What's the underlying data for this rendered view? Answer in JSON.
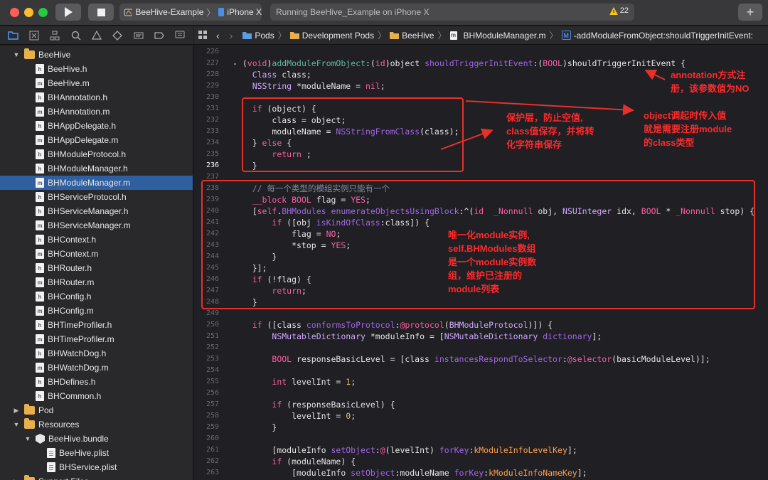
{
  "toolbar": {
    "scheme": "BeeHive-Example",
    "device": "iPhone X",
    "status": "Running BeeHive_Example on iPhone X",
    "warnings": "22",
    "colors": {
      "close": "#ff5f57",
      "minimize": "#febc2e",
      "zoom": "#28c840"
    }
  },
  "jumpbar": {
    "items": [
      "Pods",
      "Development Pods",
      "BeeHive",
      "BHModuleManager.m",
      "-addModuleFromObject:shouldTriggerInitEvent:"
    ]
  },
  "navigator": {
    "rows": [
      {
        "label": "BeeHive",
        "type": "folder",
        "indent": 1,
        "disclosure": "open"
      },
      {
        "label": "BeeHive.h",
        "type": "h",
        "indent": 2
      },
      {
        "label": "BeeHive.m",
        "type": "m",
        "indent": 2
      },
      {
        "label": "BHAnnotation.h",
        "type": "h",
        "indent": 2
      },
      {
        "label": "BHAnnotation.m",
        "type": "m",
        "indent": 2
      },
      {
        "label": "BHAppDelegate.h",
        "type": "h",
        "indent": 2
      },
      {
        "label": "BHAppDelegate.m",
        "type": "m",
        "indent": 2
      },
      {
        "label": "BHModuleProtocol.h",
        "type": "h",
        "indent": 2
      },
      {
        "label": "BHModuleManager.h",
        "type": "h",
        "indent": 2
      },
      {
        "label": "BHModuleManager.m",
        "type": "m",
        "indent": 2,
        "selected": true
      },
      {
        "label": "BHServiceProtocol.h",
        "type": "h",
        "indent": 2
      },
      {
        "label": "BHServiceManager.h",
        "type": "h",
        "indent": 2
      },
      {
        "label": "BHServiceManager.m",
        "type": "m",
        "indent": 2
      },
      {
        "label": "BHContext.h",
        "type": "h",
        "indent": 2
      },
      {
        "label": "BHContext.m",
        "type": "m",
        "indent": 2
      },
      {
        "label": "BHRouter.h",
        "type": "h",
        "indent": 2
      },
      {
        "label": "BHRouter.m",
        "type": "m",
        "indent": 2
      },
      {
        "label": "BHConfig.h",
        "type": "h",
        "indent": 2
      },
      {
        "label": "BHConfig.m",
        "type": "m",
        "indent": 2
      },
      {
        "label": "BHTimeProfiler.h",
        "type": "h",
        "indent": 2
      },
      {
        "label": "BHTimeProfiler.m",
        "type": "m",
        "indent": 2
      },
      {
        "label": "BHWatchDog.h",
        "type": "h",
        "indent": 2
      },
      {
        "label": "BHWatchDog.m",
        "type": "m",
        "indent": 2
      },
      {
        "label": "BHDefines.h",
        "type": "h",
        "indent": 2
      },
      {
        "label": "BHCommon.h",
        "type": "h",
        "indent": 2
      },
      {
        "label": "Pod",
        "type": "folder",
        "indent": 1,
        "disclosure": "closed"
      },
      {
        "label": "Resources",
        "type": "folder",
        "indent": 1,
        "disclosure": "open"
      },
      {
        "label": "BeeHive.bundle",
        "type": "bundle",
        "indent": 2,
        "disclosure": "open"
      },
      {
        "label": "BeeHive.plist",
        "type": "plist",
        "indent": 3
      },
      {
        "label": "BHService.plist",
        "type": "plist",
        "indent": 3
      },
      {
        "label": "Support Files",
        "type": "folder",
        "indent": 1,
        "disclosure": "closed"
      }
    ]
  },
  "editor": {
    "current_line": "236",
    "lines": [
      {
        "n": "226",
        "tokens": []
      },
      {
        "n": "227",
        "tokens": [
          [
            "- (",
            "p"
          ],
          [
            "void",
            "k"
          ],
          [
            ")",
            "p"
          ],
          [
            "addModuleFromObject",
            "fn"
          ],
          [
            ":(",
            "p"
          ],
          [
            "id",
            "k"
          ],
          [
            ")object ",
            "p"
          ],
          [
            "shouldTriggerInitEvent",
            "pa"
          ],
          [
            ":(",
            "p"
          ],
          [
            "BOOL",
            "k"
          ],
          [
            ")shouldTriggerInitEvent {",
            "p"
          ]
        ]
      },
      {
        "n": "228",
        "tokens": [
          [
            "    ",
            "p"
          ],
          [
            "Class",
            "t"
          ],
          [
            " class;",
            "p"
          ]
        ]
      },
      {
        "n": "229",
        "tokens": [
          [
            "    ",
            "p"
          ],
          [
            "NSString",
            "t"
          ],
          [
            " *moduleName = ",
            "p"
          ],
          [
            "nil",
            "k"
          ],
          [
            ";",
            "p"
          ]
        ]
      },
      {
        "n": "230",
        "tokens": []
      },
      {
        "n": "231",
        "tokens": [
          [
            "    ",
            "p"
          ],
          [
            "if",
            "k"
          ],
          [
            " (object) {",
            "p"
          ]
        ]
      },
      {
        "n": "232",
        "tokens": [
          [
            "        class = object;",
            "p"
          ]
        ]
      },
      {
        "n": "233",
        "tokens": [
          [
            "        moduleName = ",
            "p"
          ],
          [
            "NSStringFromClass",
            "pa"
          ],
          [
            "(class);",
            "p"
          ]
        ]
      },
      {
        "n": "234",
        "tokens": [
          [
            "    } ",
            "p"
          ],
          [
            "else",
            "k"
          ],
          [
            " {",
            "p"
          ]
        ]
      },
      {
        "n": "235",
        "tokens": [
          [
            "        ",
            "p"
          ],
          [
            "return",
            "k"
          ],
          [
            " ;",
            "p"
          ]
        ]
      },
      {
        "n": "236",
        "tokens": [
          [
            "    }",
            "p"
          ]
        ]
      },
      {
        "n": "237",
        "tokens": []
      },
      {
        "n": "238",
        "tokens": [
          [
            "    ",
            "p"
          ],
          [
            "// 每一个类型的模组实例只能有一个",
            "c"
          ]
        ]
      },
      {
        "n": "239",
        "tokens": [
          [
            "    ",
            "p"
          ],
          [
            "__block",
            "k"
          ],
          [
            " ",
            "p"
          ],
          [
            "BOOL",
            "k"
          ],
          [
            " flag = ",
            "p"
          ],
          [
            "YES",
            "k"
          ],
          [
            ";",
            "p"
          ]
        ]
      },
      {
        "n": "240",
        "tokens": [
          [
            "    [",
            "p"
          ],
          [
            "self",
            "k"
          ],
          [
            ".",
            "p"
          ],
          [
            "BHModules",
            "pa"
          ],
          [
            " ",
            "p"
          ],
          [
            "enumerateObjectsUsingBlock",
            "pa"
          ],
          [
            ":^(",
            "p"
          ],
          [
            "id",
            "k"
          ],
          [
            "  ",
            "p"
          ],
          [
            "_Nonnull",
            "k"
          ],
          [
            " obj, ",
            "p"
          ],
          [
            "NSUInteger",
            "t"
          ],
          [
            " idx, ",
            "p"
          ],
          [
            "BOOL",
            "k"
          ],
          [
            " * ",
            "p"
          ],
          [
            "_Nonnull",
            "k"
          ],
          [
            " stop) {",
            "p"
          ]
        ]
      },
      {
        "n": "241",
        "tokens": [
          [
            "        ",
            "p"
          ],
          [
            "if",
            "k"
          ],
          [
            " ([obj ",
            "p"
          ],
          [
            "isKindOfClass",
            "pa"
          ],
          [
            ":class]) {",
            "p"
          ]
        ]
      },
      {
        "n": "242",
        "tokens": [
          [
            "            flag = ",
            "p"
          ],
          [
            "NO",
            "k"
          ],
          [
            ";",
            "p"
          ]
        ]
      },
      {
        "n": "243",
        "tokens": [
          [
            "            *stop = ",
            "p"
          ],
          [
            "YES",
            "k"
          ],
          [
            ";",
            "p"
          ]
        ]
      },
      {
        "n": "244",
        "tokens": [
          [
            "        }",
            "p"
          ]
        ]
      },
      {
        "n": "245",
        "tokens": [
          [
            "    }];",
            "p"
          ]
        ]
      },
      {
        "n": "246",
        "tokens": [
          [
            "    ",
            "p"
          ],
          [
            "if",
            "k"
          ],
          [
            " (!flag) {",
            "p"
          ]
        ]
      },
      {
        "n": "247",
        "tokens": [
          [
            "        ",
            "p"
          ],
          [
            "return",
            "k"
          ],
          [
            ";",
            "p"
          ]
        ]
      },
      {
        "n": "248",
        "tokens": [
          [
            "    }",
            "p"
          ]
        ]
      },
      {
        "n": "249",
        "tokens": []
      },
      {
        "n": "250",
        "tokens": [
          [
            "    ",
            "p"
          ],
          [
            "if",
            "k"
          ],
          [
            " ([class ",
            "p"
          ],
          [
            "conformsToProtocol",
            "pa"
          ],
          [
            ":",
            "p"
          ],
          [
            "@protocol",
            "k"
          ],
          [
            "(",
            "p"
          ],
          [
            "BHModuleProtocol",
            "t"
          ],
          [
            ")]) {",
            "p"
          ]
        ]
      },
      {
        "n": "251",
        "tokens": [
          [
            "        ",
            "p"
          ],
          [
            "NSMutableDictionary",
            "t"
          ],
          [
            " *moduleInfo = [",
            "p"
          ],
          [
            "NSMutableDictionary",
            "t"
          ],
          [
            " ",
            "p"
          ],
          [
            "dictionary",
            "pa"
          ],
          [
            "];",
            "p"
          ]
        ]
      },
      {
        "n": "252",
        "tokens": []
      },
      {
        "n": "253",
        "tokens": [
          [
            "        ",
            "p"
          ],
          [
            "BOOL",
            "k"
          ],
          [
            " responseBasicLevel = [class ",
            "p"
          ],
          [
            "instancesRespondToSelector",
            "pa"
          ],
          [
            ":",
            "p"
          ],
          [
            "@selector",
            "k"
          ],
          [
            "(basicModuleLevel)];",
            "p"
          ]
        ]
      },
      {
        "n": "254",
        "tokens": []
      },
      {
        "n": "255",
        "tokens": [
          [
            "        ",
            "p"
          ],
          [
            "int",
            "k"
          ],
          [
            " levelInt = ",
            "p"
          ],
          [
            "1",
            "num"
          ],
          [
            ";",
            "p"
          ]
        ]
      },
      {
        "n": "256",
        "tokens": []
      },
      {
        "n": "257",
        "tokens": [
          [
            "        ",
            "p"
          ],
          [
            "if",
            "k"
          ],
          [
            " (responseBasicLevel) {",
            "p"
          ]
        ]
      },
      {
        "n": "258",
        "tokens": [
          [
            "            levelInt = ",
            "p"
          ],
          [
            "0",
            "num"
          ],
          [
            ";",
            "p"
          ]
        ]
      },
      {
        "n": "259",
        "tokens": [
          [
            "        }",
            "p"
          ]
        ]
      },
      {
        "n": "260",
        "tokens": []
      },
      {
        "n": "261",
        "tokens": [
          [
            "        [moduleInfo ",
            "p"
          ],
          [
            "setObject",
            "pa"
          ],
          [
            ":",
            "p"
          ],
          [
            "@",
            "k"
          ],
          [
            "(levelInt) ",
            "p"
          ],
          [
            "forKey",
            "pa"
          ],
          [
            ":",
            "p"
          ],
          [
            "kModuleInfoLevelKey",
            "pm"
          ],
          [
            "];",
            "p"
          ]
        ]
      },
      {
        "n": "262",
        "tokens": [
          [
            "        ",
            "p"
          ],
          [
            "if",
            "k"
          ],
          [
            " (moduleName) {",
            "p"
          ]
        ]
      },
      {
        "n": "263",
        "tokens": [
          [
            "            [moduleInfo ",
            "p"
          ],
          [
            "setObject",
            "pa"
          ],
          [
            ":moduleName ",
            "p"
          ],
          [
            "forKey",
            "pa"
          ],
          [
            ":",
            "p"
          ],
          [
            "kModuleInfoNameKey",
            "pm"
          ],
          [
            "];",
            "p"
          ]
        ]
      }
    ],
    "colors": {
      "p": "#e6e6e6",
      "k": "#fc5fa3",
      "t": "#d0a8ff",
      "fn": "#67b7a4",
      "pa": "#a167e6",
      "c": "#7f8c98",
      "num": "#d0bf69",
      "pm": "#ffa14f"
    }
  },
  "annotations": {
    "note1": [
      "annotation方式注",
      "册，该参数值为NO"
    ],
    "note2": [
      "object调起时传入值",
      "就是需要注册module",
      "的class类型"
    ],
    "note3": [
      "保护层，防止空值,",
      "class值保存，并将转",
      "化字符串保存"
    ],
    "note4": [
      "唯一化module实例,",
      "self.BHModules数组",
      "是一个module实例数",
      "组，维护已注册的",
      "module列表"
    ],
    "color": "#ff2a2a"
  }
}
